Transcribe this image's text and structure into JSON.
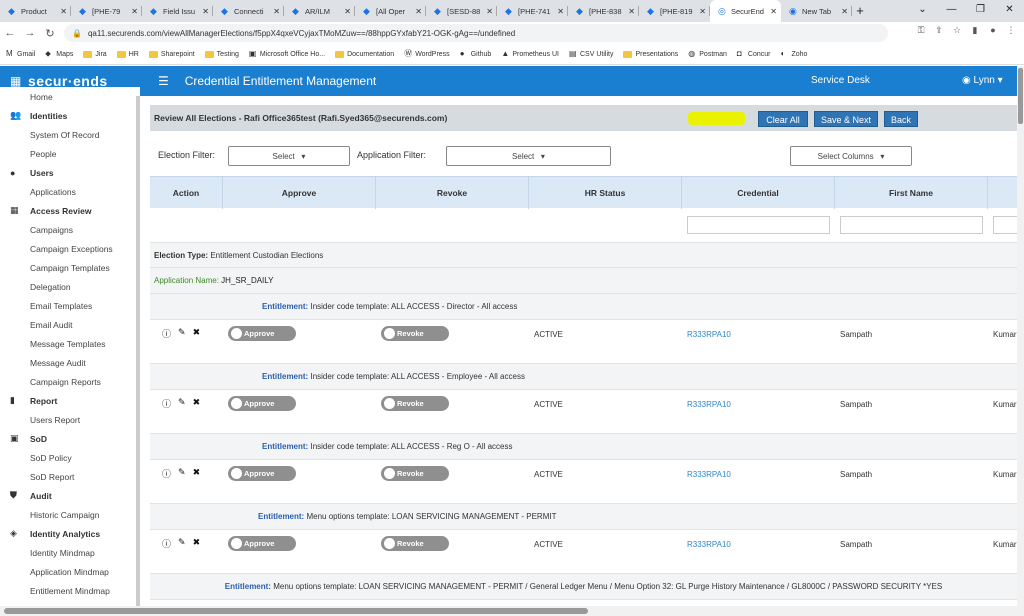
{
  "browser": {
    "tabs": [
      {
        "label": "Product",
        "icon": "jira-icon"
      },
      {
        "label": "[PHE-79",
        "icon": "jira-icon"
      },
      {
        "label": "Field Issu",
        "icon": "jira-icon"
      },
      {
        "label": "Connecti",
        "icon": "jira-icon"
      },
      {
        "label": "AR/ILM",
        "icon": "jira-icon"
      },
      {
        "label": "[All Oper",
        "icon": "jira-icon"
      },
      {
        "label": "[SESD-88",
        "icon": "jira-icon"
      },
      {
        "label": "[PHE-741",
        "icon": "jira-icon"
      },
      {
        "label": "[PHE-838",
        "icon": "jira-icon"
      },
      {
        "label": "[PHE-819",
        "icon": "jira-icon"
      },
      {
        "label": "SecurEnd",
        "icon": "securends-icon"
      },
      {
        "label": "New Tab",
        "icon": "chrome-icon"
      }
    ],
    "url": "qa11.securends.com/viewAllManagerElections/f5ppX4qxeVCyjaxTMoMZuw==/88hppGYxfabY21-OGK-gAg==/undefined",
    "bookmarks": [
      {
        "label": "Gmail",
        "icon": "gmail-icon"
      },
      {
        "label": "Maps",
        "icon": "maps-icon"
      },
      {
        "label": "Jira",
        "icon": "folder-icon"
      },
      {
        "label": "HR",
        "icon": "folder-icon"
      },
      {
        "label": "Sharepoint",
        "icon": "folder-icon"
      },
      {
        "label": "Testing",
        "icon": "folder-icon"
      },
      {
        "label": "Microsoft Office Ho...",
        "icon": "office-icon"
      },
      {
        "label": "Documentation",
        "icon": "folder-icon"
      },
      {
        "label": "WordPress",
        "icon": "wordpress-icon"
      },
      {
        "label": "Github",
        "icon": "github-icon"
      },
      {
        "label": "Prometheus UI",
        "icon": "prometheus-icon"
      },
      {
        "label": "CSV Utility",
        "icon": "csv-icon"
      },
      {
        "label": "Presentations",
        "icon": "folder-icon"
      },
      {
        "label": "Postman",
        "icon": "postman-icon"
      },
      {
        "label": "Concur",
        "icon": "concur-icon"
      },
      {
        "label": "Zoho",
        "icon": "zoho-icon"
      }
    ]
  },
  "app": {
    "logo": "secur·ends",
    "title": "Credential Entitlement Management",
    "service_desk": "Service Desk",
    "user": "Lynn",
    "brand_color": "#1a7fd0"
  },
  "sidebar": [
    {
      "type": "sub",
      "label": "Home"
    },
    {
      "type": "sec",
      "label": "Identities",
      "icon": "users-icon"
    },
    {
      "type": "sub",
      "label": "System Of Record"
    },
    {
      "type": "sub",
      "label": "People"
    },
    {
      "type": "sec",
      "label": "Users",
      "icon": "user-icon"
    },
    {
      "type": "sub",
      "label": "Applications"
    },
    {
      "type": "sec",
      "label": "Access Review",
      "icon": "grid-icon"
    },
    {
      "type": "sub",
      "label": "Campaigns"
    },
    {
      "type": "sub",
      "label": "Campaign Exceptions"
    },
    {
      "type": "sub",
      "label": "Campaign Templates"
    },
    {
      "type": "sub",
      "label": "Delegation"
    },
    {
      "type": "sub",
      "label": "Email Templates"
    },
    {
      "type": "sub",
      "label": "Email Audit"
    },
    {
      "type": "sub",
      "label": "Message Templates"
    },
    {
      "type": "sub",
      "label": "Message Audit"
    },
    {
      "type": "sub",
      "label": "Campaign Reports"
    },
    {
      "type": "sec",
      "label": "Report",
      "icon": "report-icon"
    },
    {
      "type": "sub",
      "label": "Users Report"
    },
    {
      "type": "sec",
      "label": "SoD",
      "icon": "sod-icon"
    },
    {
      "type": "sub",
      "label": "SoD Policy"
    },
    {
      "type": "sub",
      "label": "SoD Report"
    },
    {
      "type": "sec",
      "label": "Audit",
      "icon": "shield-icon"
    },
    {
      "type": "sub",
      "label": "Historic Campaign"
    },
    {
      "type": "sec",
      "label": "Identity Analytics",
      "icon": "analytics-icon"
    },
    {
      "type": "sub",
      "label": "Identity Mindmap"
    },
    {
      "type": "sub",
      "label": "Application Mindmap"
    },
    {
      "type": "sub",
      "label": "Entitlement Mindmap"
    }
  ],
  "page": {
    "header": "Review All Elections - Rafi Office365test (Rafi.Syed365@securends.com)",
    "buttons": {
      "clear_all": "Clear All",
      "save_next": "Save & Next",
      "back": "Back"
    },
    "election_filter_label": "Election Filter:",
    "application_filter_label": "Application Filter:",
    "select_placeholder": "Select",
    "select_columns": "Select Columns",
    "columns": [
      "Action",
      "Approve",
      "Revoke",
      "HR Status",
      "Credential",
      "First Name"
    ],
    "election_type_label": "Election Type:",
    "election_type": "Entitlement Custodian Elections",
    "application_name_label": "Application Name:",
    "application_name": "JH_SR_DAILY",
    "entitlement_label": "Entitlement:",
    "approve_label": "Approve",
    "revoke_label": "Revoke"
  },
  "rows": [
    {
      "entitlement": "Insider code template: ALL ACCESS - Director - All access",
      "hr_status": "ACTIVE",
      "credential": "R333RPA10",
      "first_name": "Sampath",
      "last_name": "Kumar"
    },
    {
      "entitlement": "Insider code template: ALL ACCESS - Employee - All access",
      "hr_status": "ACTIVE",
      "credential": "R333RPA10",
      "first_name": "Sampath",
      "last_name": "Kumar"
    },
    {
      "entitlement": "Insider code template: ALL ACCESS - Reg O - All access",
      "hr_status": "ACTIVE",
      "credential": "R333RPA10",
      "first_name": "Sampath",
      "last_name": "Kumar"
    },
    {
      "entitlement": "Menu options template: LOAN SERVICING MANAGEMENT - PERMIT",
      "hr_status": "ACTIVE",
      "credential": "R333RPA10",
      "first_name": "Sampath",
      "last_name": "Kumar"
    }
  ],
  "last_entitlement": "Menu options template: LOAN SERVICING MANAGEMENT - PERMIT / General Ledger Menu / Menu Option 32: GL Purge History Maintenance / GL8000C / PASSWORD SECURITY *YES"
}
